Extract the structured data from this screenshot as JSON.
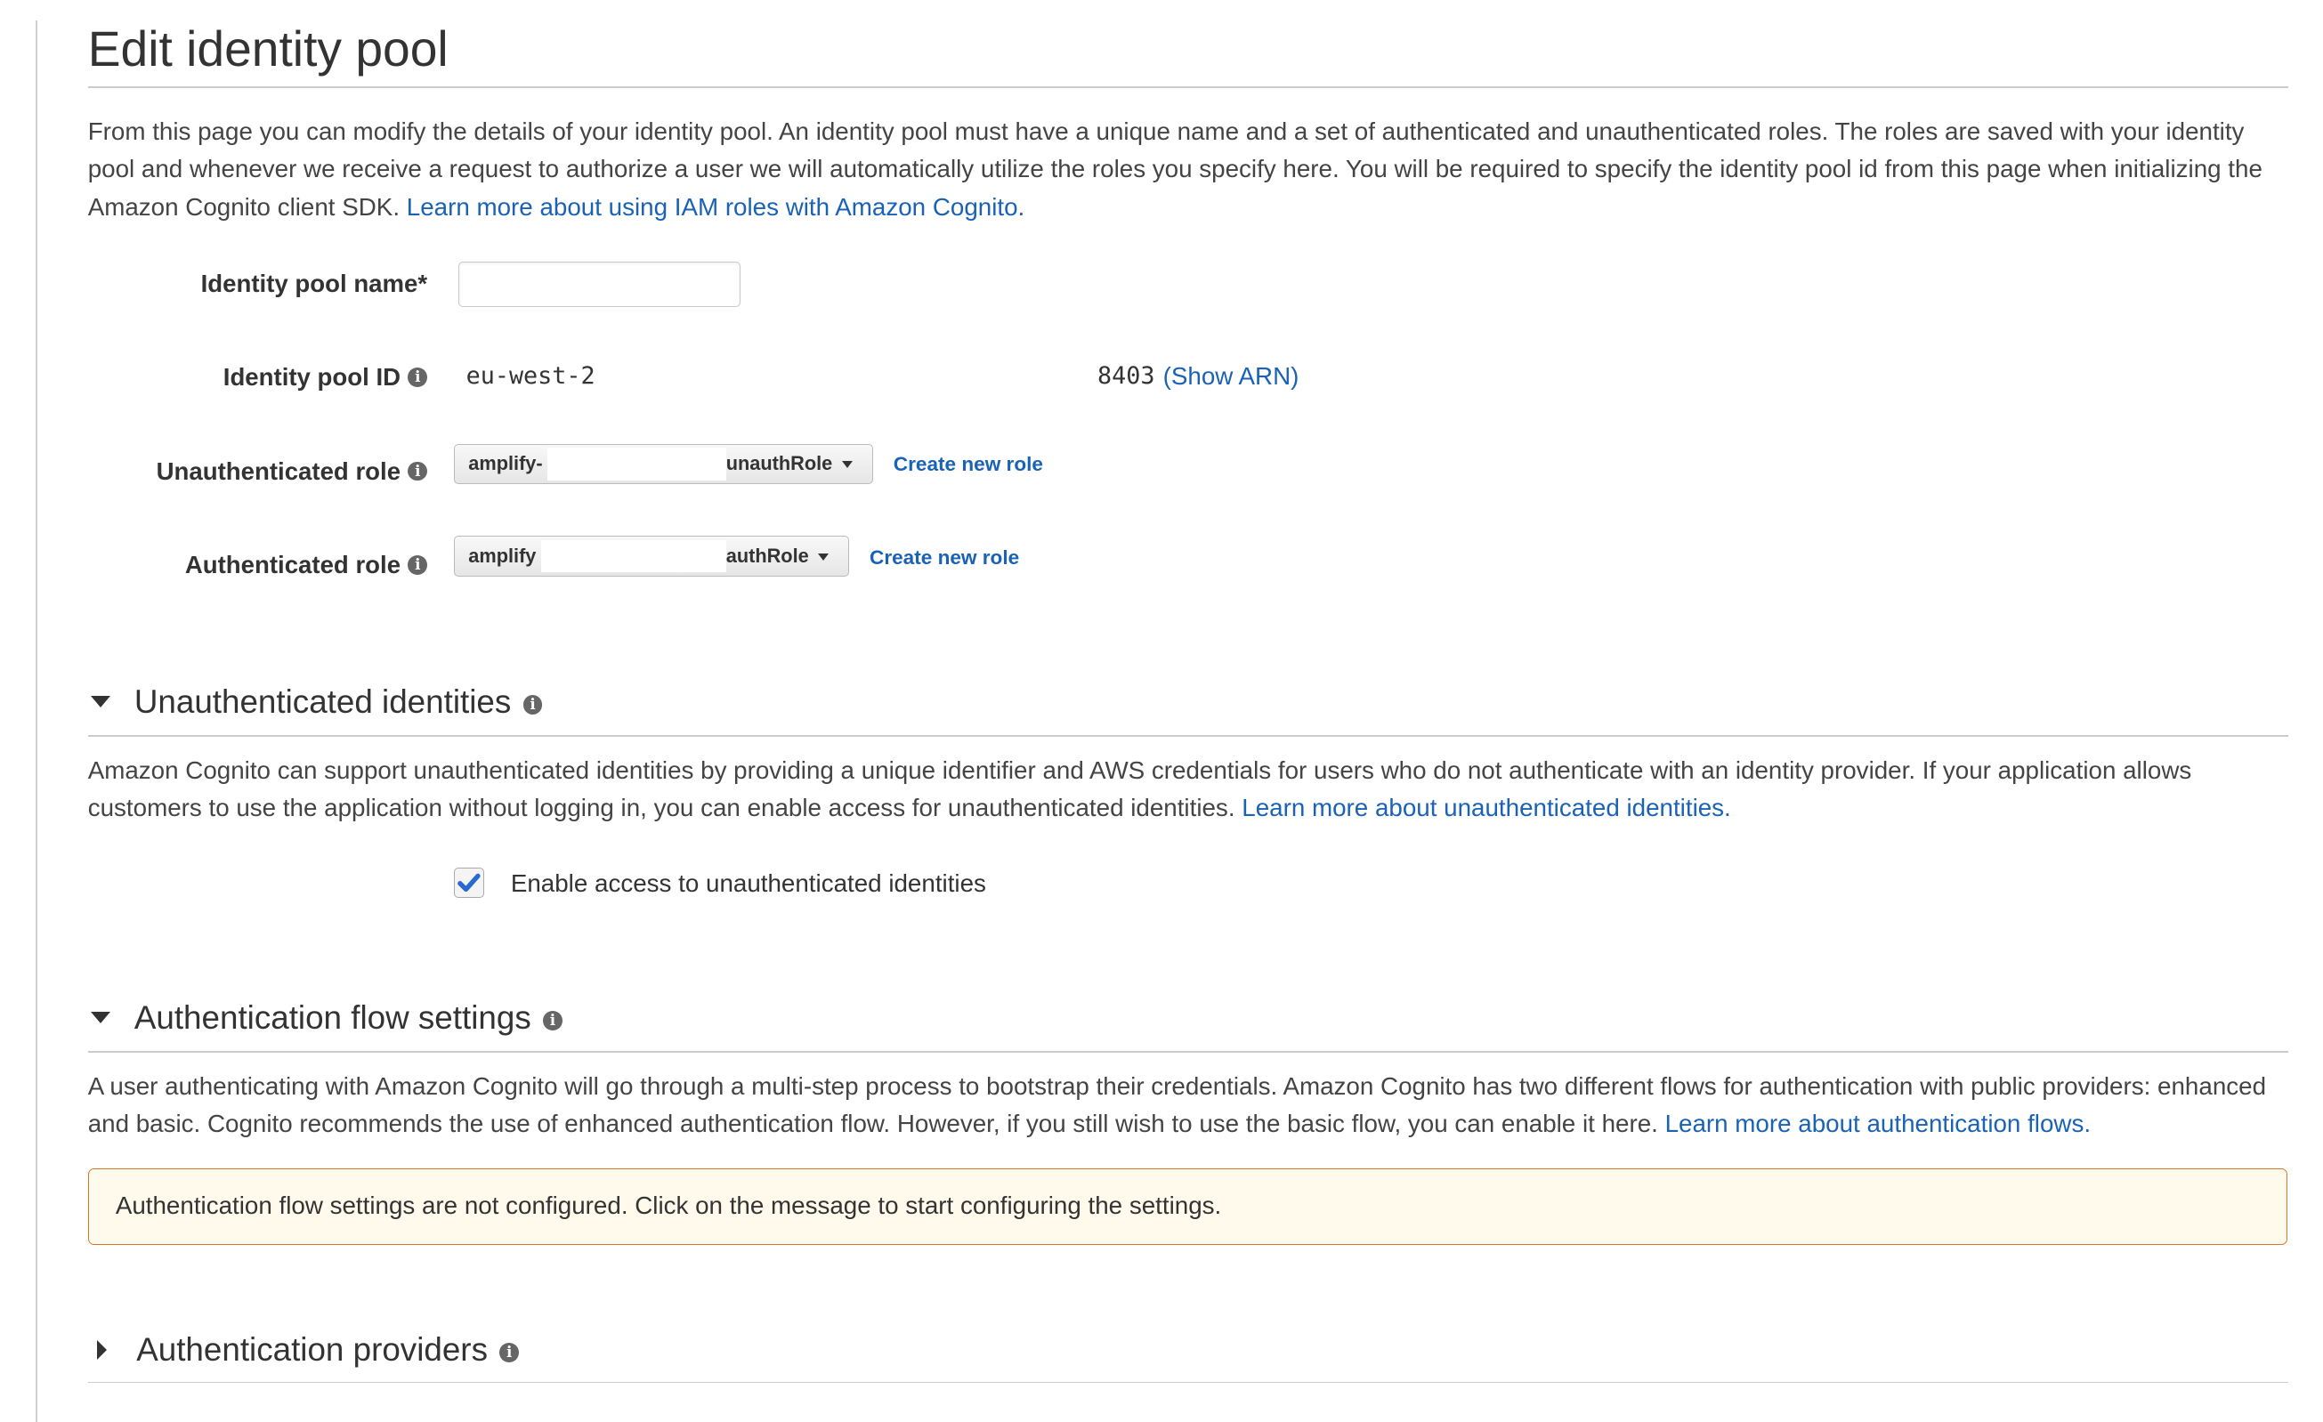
{
  "page": {
    "title": "Edit identity pool"
  },
  "intro": {
    "text": "From this page you can modify the details of your identity pool. An identity pool must have a unique name and a set of authenticated and unauthenticated roles. The roles are saved with your identity pool and whenever we receive a request to authorize a user we will automatically utilize the roles you specify here. You will be required to specify the identity pool id from this page when initializing the Amazon Cognito client SDK.",
    "link": "Learn more about using IAM roles with Amazon Cognito."
  },
  "form": {
    "pool_name_label": "Identity pool name*",
    "pool_name_value": "",
    "pool_id_label": "Identity pool ID",
    "pool_id_prefix": "eu-west-2",
    "pool_id_suffix": "8403",
    "show_arn": "(Show ARN)",
    "unauth_role_label": "Unauthenticated role",
    "unauth_role_prefix": "amplify-",
    "unauth_role_suffix": "unauthRole",
    "auth_role_label": "Authenticated role",
    "auth_role_prefix": "amplify",
    "auth_role_suffix": "authRole",
    "create_new_role": "Create new role"
  },
  "unauth_section": {
    "title": "Unauthenticated identities",
    "text": "Amazon Cognito can support unauthenticated identities by providing a unique identifier and AWS credentials for users who do not authenticate with an identity provider. If your application allows customers to use the application without logging in, you can enable access for unauthenticated identities.",
    "link": "Learn more about unauthenticated identities.",
    "checkbox_label": "Enable access to unauthenticated identities",
    "checked": true
  },
  "flow_section": {
    "title": "Authentication flow settings",
    "text": "A user authenticating with Amazon Cognito will go through a multi-step process to bootstrap their credentials. Amazon Cognito has two different flows for authentication with public providers: enhanced and basic. Cognito recommends the use of enhanced authentication flow. However, if you still wish to use the basic flow, you can enable it here.",
    "link": "Learn more about authentication flows.",
    "warning": "Authentication flow settings are not configured. Click on the message to start configuring the settings."
  },
  "providers_section": {
    "title": "Authentication providers",
    "expanded": false
  },
  "colors": {
    "link": "#1a62b6",
    "warning_border": "#d5762b",
    "warning_bg": "#fffaeb",
    "checkbox_check": "#2a6ad0"
  }
}
